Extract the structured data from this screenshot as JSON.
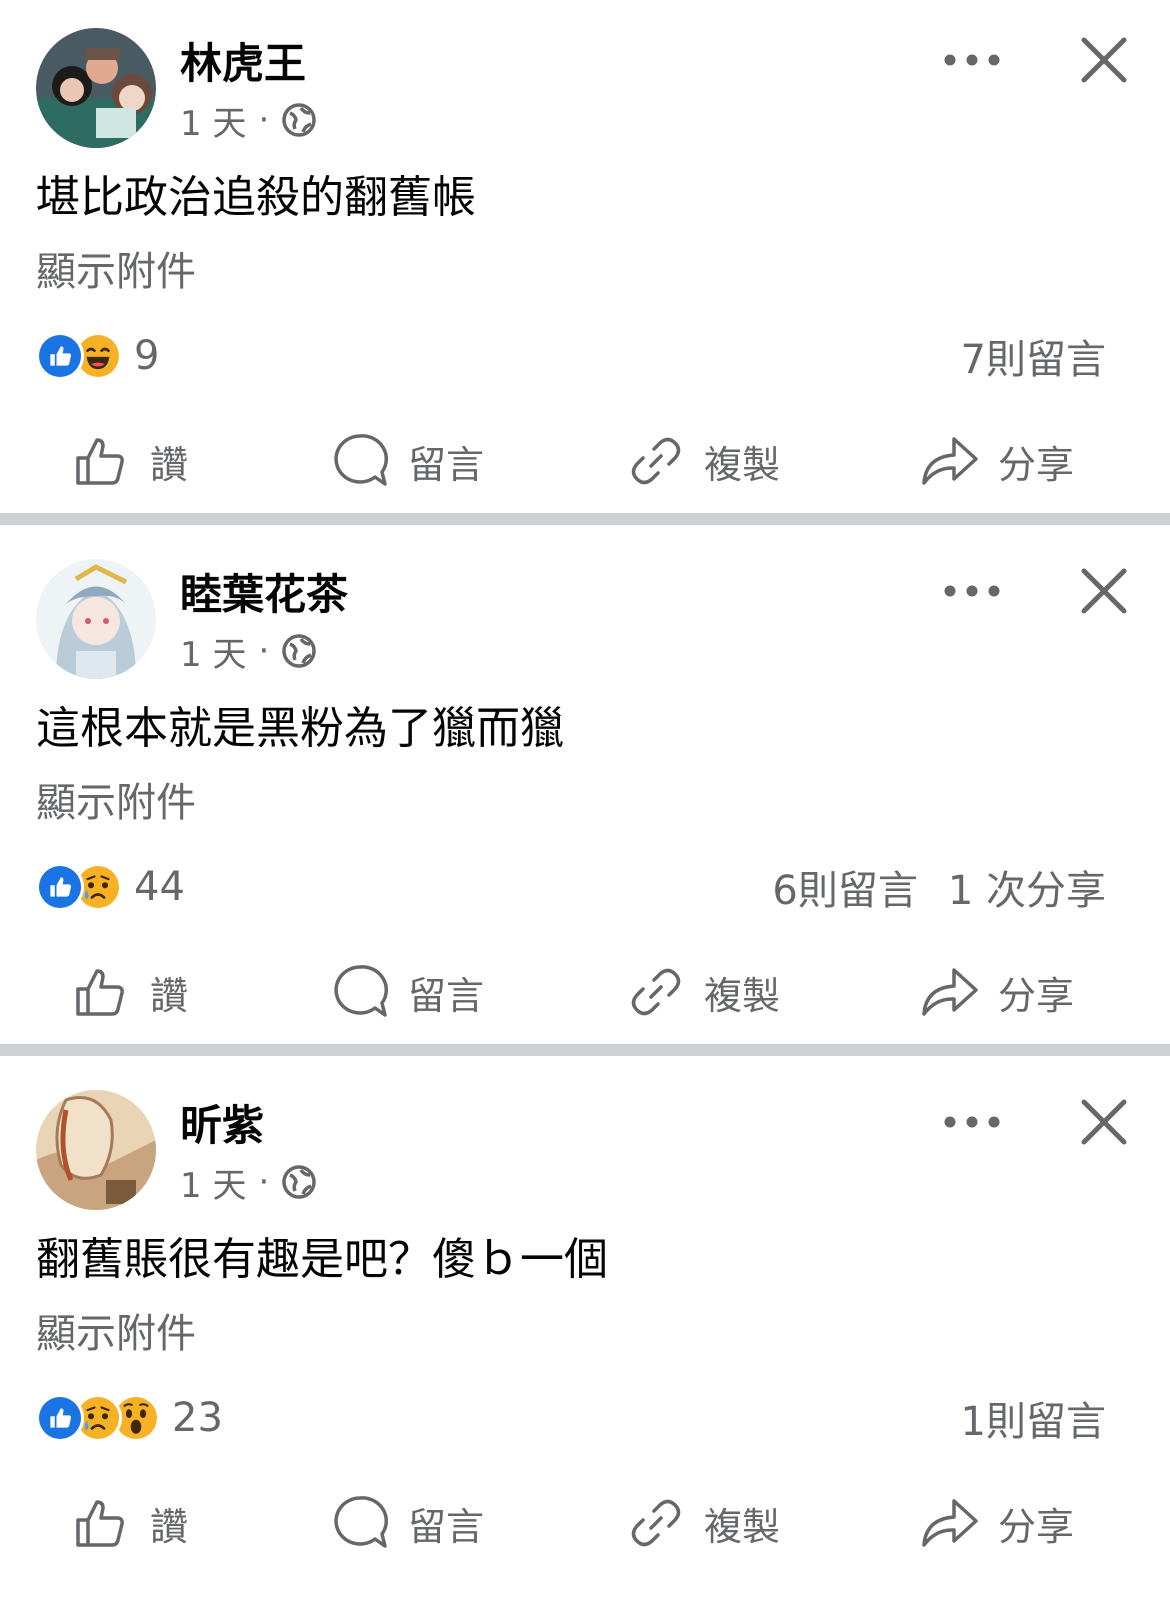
{
  "posts": [
    {
      "author": "林虎王",
      "time": "1 天",
      "dot": "·",
      "text": "堪比政治追殺的翻舊帳",
      "attachment": "顯示附件",
      "reactions": [
        "like",
        "haha"
      ],
      "reaction_count": "9",
      "comments": "7則留言",
      "shares": ""
    },
    {
      "author": "睦葉花茶",
      "time": "1 天",
      "dot": "·",
      "text": "這根本就是黑粉為了獵而獵",
      "attachment": "顯示附件",
      "reactions": [
        "like",
        "sad"
      ],
      "reaction_count": "44",
      "comments": "6則留言",
      "shares": "1 次分享"
    },
    {
      "author": "昕紫",
      "time": "1 天",
      "dot": "·",
      "text": "翻舊賬很有趣是吧？傻ｂ一個",
      "attachment": "顯示附件",
      "reactions": [
        "like",
        "sad",
        "wow"
      ],
      "reaction_count": "23",
      "comments": "1則留言",
      "shares": ""
    }
  ],
  "actions": {
    "like": "讚",
    "comment": "留言",
    "copy": "複製",
    "share": "分享"
  },
  "colors": {
    "like_blue": "#1b74e4",
    "emoji_yellow": "#f7b125",
    "muted": "#65676b",
    "divider": "#ced0d4"
  },
  "icons": [
    "globe-icon",
    "more-icon",
    "close-icon",
    "like-icon",
    "comment-icon",
    "link-icon",
    "share-icon"
  ]
}
